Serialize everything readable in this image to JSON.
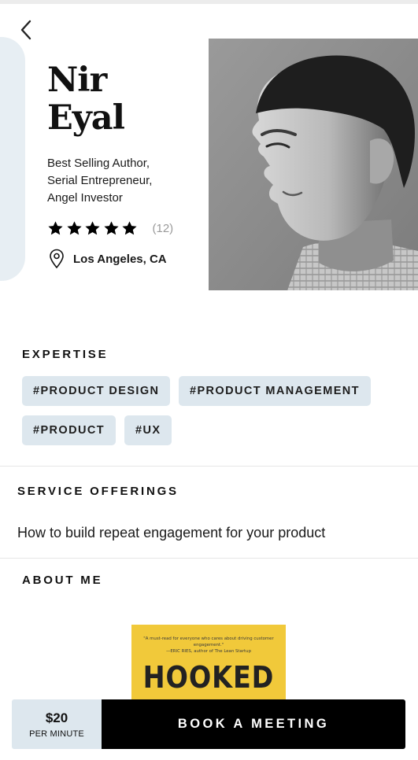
{
  "profile": {
    "first_name": "Nir",
    "last_name": "Eyal",
    "bio_lines": [
      "Best Selling Author,",
      "Serial Entrepreneur,",
      "Angel Investor"
    ],
    "rating_stars": 5,
    "review_count": "(12)",
    "location": "Los Angeles, CA"
  },
  "expertise": {
    "title": "EXPERTISE",
    "tags": [
      "#PRODUCT DESIGN",
      "#PRODUCT MANAGEMENT",
      "#PRODUCT",
      "#UX"
    ]
  },
  "services": {
    "title": "SERVICE OFFERINGS",
    "items": [
      "How to build repeat engagement for your product"
    ]
  },
  "about": {
    "title": "ABOUT ME",
    "book": {
      "quote_line1": "\"A must-read for everyone who cares about driving customer engagement.\"",
      "quote_line2": "—ERIC RIES, author of The Lean Startup",
      "title": "HOOKED"
    }
  },
  "booking": {
    "price": "$20",
    "price_unit": "PER MINUTE",
    "button_label": "BOOK A MEETING"
  },
  "icons": {
    "back": "chevron-left-icon",
    "star": "star-icon",
    "location": "map-pin-icon"
  },
  "colors": {
    "accent_light": "#dde7ee",
    "button_bg": "#000000",
    "text": "#111111",
    "muted": "#9a9a9a"
  }
}
